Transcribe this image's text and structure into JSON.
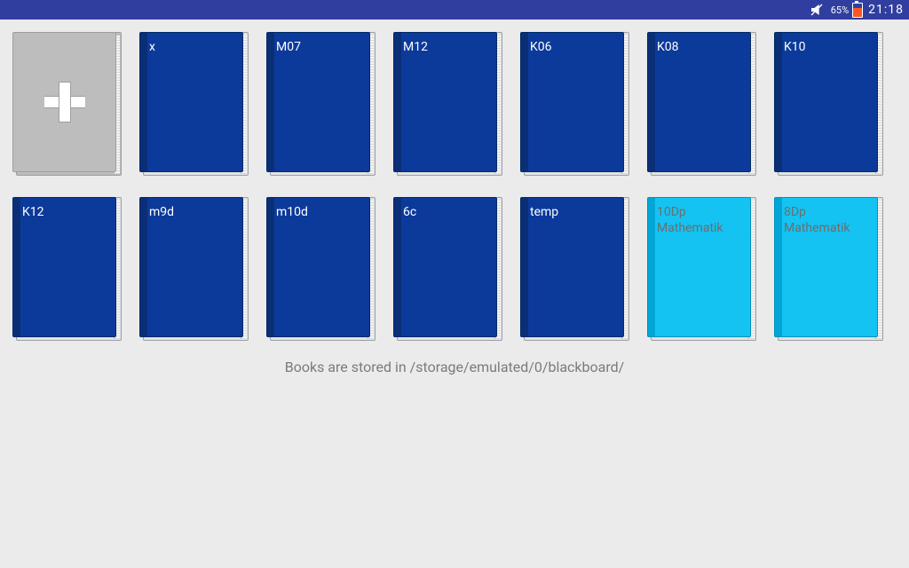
{
  "statusbar": {
    "battery_percent": "65%",
    "clock": "21:18"
  },
  "books": [
    {
      "title": "x",
      "variant": "blue"
    },
    {
      "title": "M07",
      "variant": "blue"
    },
    {
      "title": "M12",
      "variant": "blue"
    },
    {
      "title": "K06",
      "variant": "blue"
    },
    {
      "title": "K08",
      "variant": "blue"
    },
    {
      "title": "K10",
      "variant": "blue"
    },
    {
      "title": "K12",
      "variant": "blue"
    },
    {
      "title": "m9d",
      "variant": "blue"
    },
    {
      "title": "m10d",
      "variant": "blue"
    },
    {
      "title": "6c",
      "variant": "blue"
    },
    {
      "title": "temp",
      "variant": "blue"
    },
    {
      "title": "10Dp Mathematik",
      "variant": "cyan"
    },
    {
      "title": "8Dp Mathematik",
      "variant": "cyan"
    }
  ],
  "storage_message": "Books are stored in /storage/emulated/0/blackboard/"
}
